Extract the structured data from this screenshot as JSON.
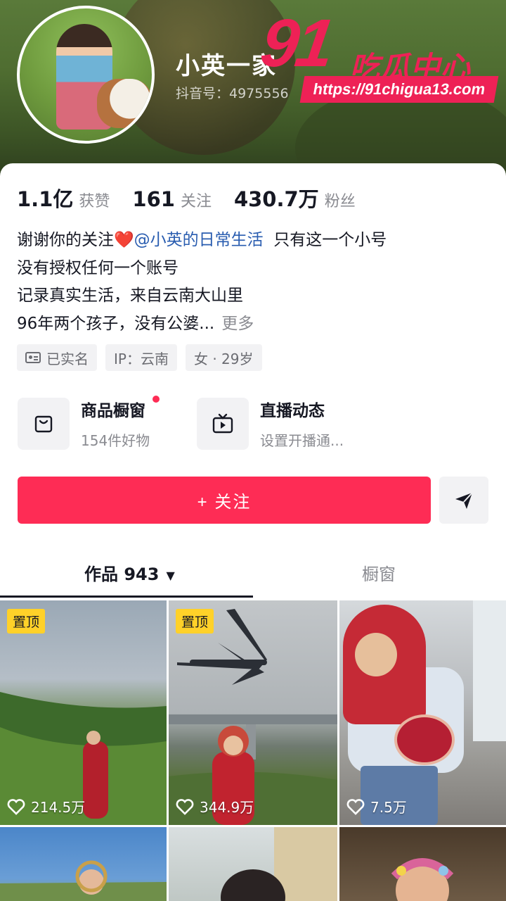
{
  "profile": {
    "username": "小英一家",
    "douyin_id": "抖音号：4975556"
  },
  "watermark": {
    "number": "91",
    "title": "吃瓜中心",
    "url": "https://91chigua13.com"
  },
  "stats": [
    {
      "value": "1.1亿",
      "label": "获赞"
    },
    {
      "value": "161",
      "label": "关注"
    },
    {
      "value": "430.7万",
      "label": "粉丝"
    }
  ],
  "bio": {
    "line1_prefix": "谢谢你的关注",
    "heart": "❤️",
    "mention": "@小英的日常生活",
    "line1_suffix": "只有这一个小号",
    "line2": "没有授权任何一个账号",
    "line3": "记录真实生活，来自云南大山里",
    "line4": "96年两个孩子，没有公婆...",
    "more": "更多"
  },
  "tags": {
    "verified": "已实名",
    "ip": "IP：云南",
    "gender_age": "女 · 29岁"
  },
  "features": {
    "shop": {
      "title": "商品橱窗",
      "subtitle": "154件好物"
    },
    "live": {
      "title": "直播动态",
      "subtitle": "设置开播通..."
    }
  },
  "actions": {
    "follow": "+ 关注"
  },
  "tabs": {
    "works": "作品 943",
    "shop": "橱窗"
  },
  "videos": [
    {
      "pinned": "置顶",
      "likes": "214.5万"
    },
    {
      "pinned": "置顶",
      "likes": "344.9万"
    },
    {
      "pinned": "",
      "likes": "7.5万"
    }
  ],
  "colors": {
    "accent": "#fe2c55",
    "pin_badge": "#ffd129",
    "mention": "#2a5db0"
  }
}
